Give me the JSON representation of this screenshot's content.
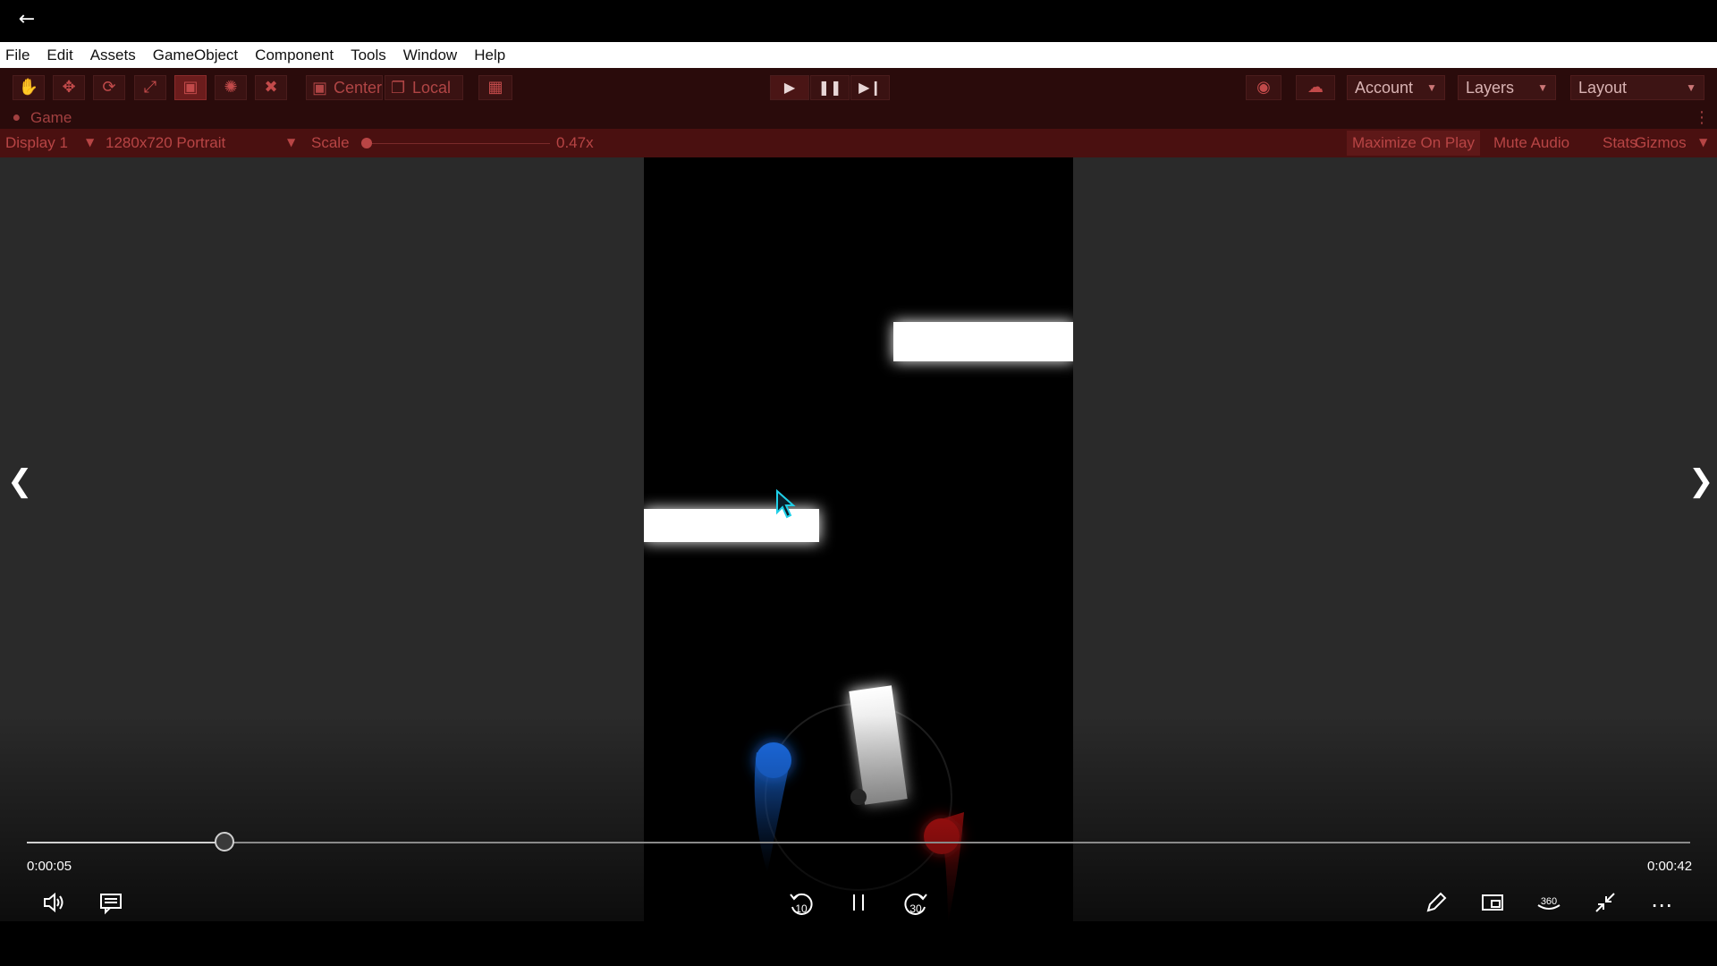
{
  "menu": [
    "File",
    "Edit",
    "Assets",
    "GameObject",
    "Component",
    "Tools",
    "Window",
    "Help"
  ],
  "toolbar": {
    "pivot_label": "Center",
    "space_label": "Local",
    "account_label": "Account",
    "layers_label": "Layers",
    "layout_label": "Layout"
  },
  "game_tab": {
    "title": "Game"
  },
  "game_bar": {
    "display": "Display 1",
    "resolution": "1280x720 Portrait",
    "scale_label": "Scale",
    "scale_value": "0.47x",
    "scale_fraction": 0.0,
    "maximize": "Maximize On Play",
    "mute": "Mute Audio",
    "stats": "Stats",
    "gizmos": "Gizmos"
  },
  "player": {
    "current_time": "0:00:05",
    "total_time": "0:00:42",
    "progress": 0.119,
    "skip_back": "10",
    "skip_forward": "30"
  },
  "colors": {
    "accent_red": "#b84545",
    "toolbar_bg": "#2a0b0b",
    "gamebar_bg": "#4a1010",
    "player_blue": "#1a6ee8",
    "player_red": "#e01515"
  }
}
